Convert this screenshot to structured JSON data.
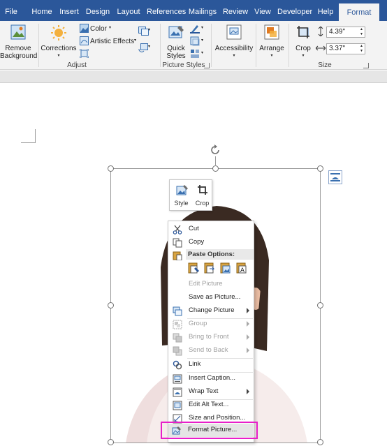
{
  "ribbon_tabs": [
    {
      "label": "File"
    },
    {
      "label": "Home"
    },
    {
      "label": "Insert"
    },
    {
      "label": "Design"
    },
    {
      "label": "Layout"
    },
    {
      "label": "References"
    },
    {
      "label": "Mailings"
    },
    {
      "label": "Review"
    },
    {
      "label": "View"
    },
    {
      "label": "Developer"
    },
    {
      "label": "Help"
    },
    {
      "label": "Format"
    }
  ],
  "active_tab": "Format",
  "ribbon": {
    "remove_background": "Remove\nBackground",
    "corrections": "Corrections",
    "color": "Color",
    "artistic_effects": "Artistic Effects",
    "adjust_group": "Adjust",
    "quick_styles": "Quick\nStyles",
    "picture_styles_group": "Picture Styles",
    "accessibility": "Accessibility",
    "arrange": "Arrange",
    "crop": "Crop",
    "height": "4.39\"",
    "width": "3.37\"",
    "size_group": "Size"
  },
  "mini_toolbar": {
    "style": "Style",
    "crop": "Crop"
  },
  "context_menu": {
    "cut": "Cut",
    "copy": "Copy",
    "paste_options": "Paste Options:",
    "edit_picture": "Edit Picture",
    "save_as_picture": "Save as Picture...",
    "change_picture": "Change Picture",
    "group": "Group",
    "bring_to_front": "Bring to Front",
    "send_to_back": "Send to Back",
    "link": "Link",
    "insert_caption": "Insert Caption...",
    "wrap_text": "Wrap Text",
    "edit_alt_text": "Edit Alt Text...",
    "size_and_position": "Size and Position...",
    "format_picture": "Format Picture..."
  },
  "colors": {
    "ribbon_blue": "#2b579a",
    "highlight_magenta": "#e81fc9"
  }
}
